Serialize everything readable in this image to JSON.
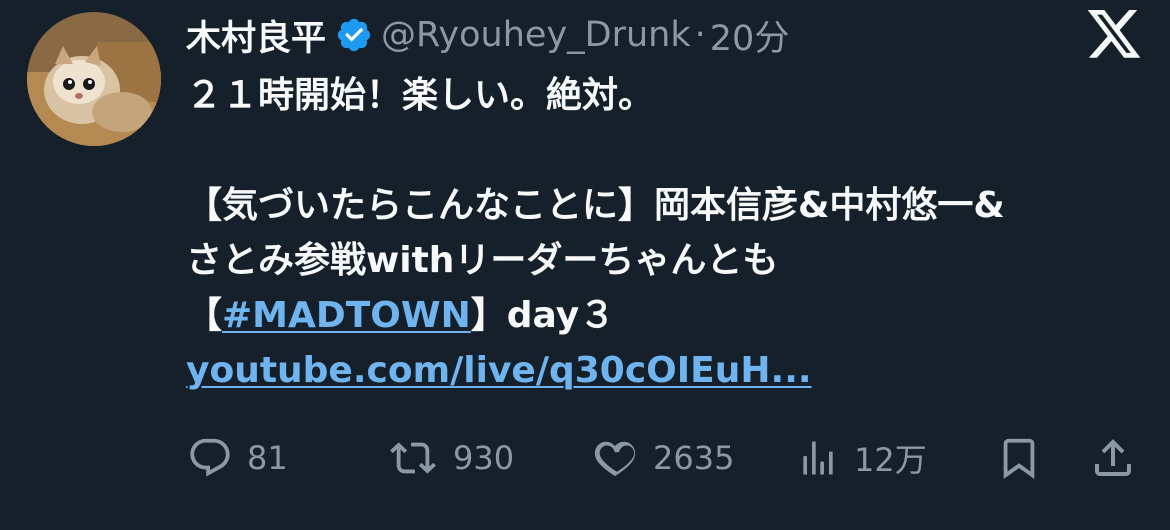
{
  "user": {
    "display_name": "木村良平",
    "handle": "@Ryouhey_Drunk",
    "separator": "·",
    "time": "20分",
    "verified_icon": "verified-badge-icon",
    "avatar_icon": "avatar-cat-photo"
  },
  "app": {
    "logo_icon": "x-logo-icon"
  },
  "tweet": {
    "line1": "２１時開始！楽しい。絶対。",
    "line2": "【気づいたらこんなことに】岡本信彦&中村悠一&",
    "line3": "さとみ参戦withリーダーちゃんとも",
    "line4_prefix": "【",
    "hashtag": "#MADTOWN",
    "line4_suffix": "】day３",
    "link": "youtube.com/live/q30cOIEuH..."
  },
  "actions": {
    "reply": {
      "icon": "reply-icon",
      "count": "81"
    },
    "retweet": {
      "icon": "retweet-icon",
      "count": "930"
    },
    "like": {
      "icon": "heart-icon",
      "count": "2635"
    },
    "views": {
      "icon": "views-icon",
      "count": "12万"
    },
    "bookmark": {
      "icon": "bookmark-icon"
    },
    "share": {
      "icon": "share-icon"
    }
  },
  "colors": {
    "background": "#15202b",
    "text": "#f7f9f9",
    "secondary": "#8b98a5",
    "link": "#6fb4ee",
    "verified": "#1d9bf0"
  }
}
